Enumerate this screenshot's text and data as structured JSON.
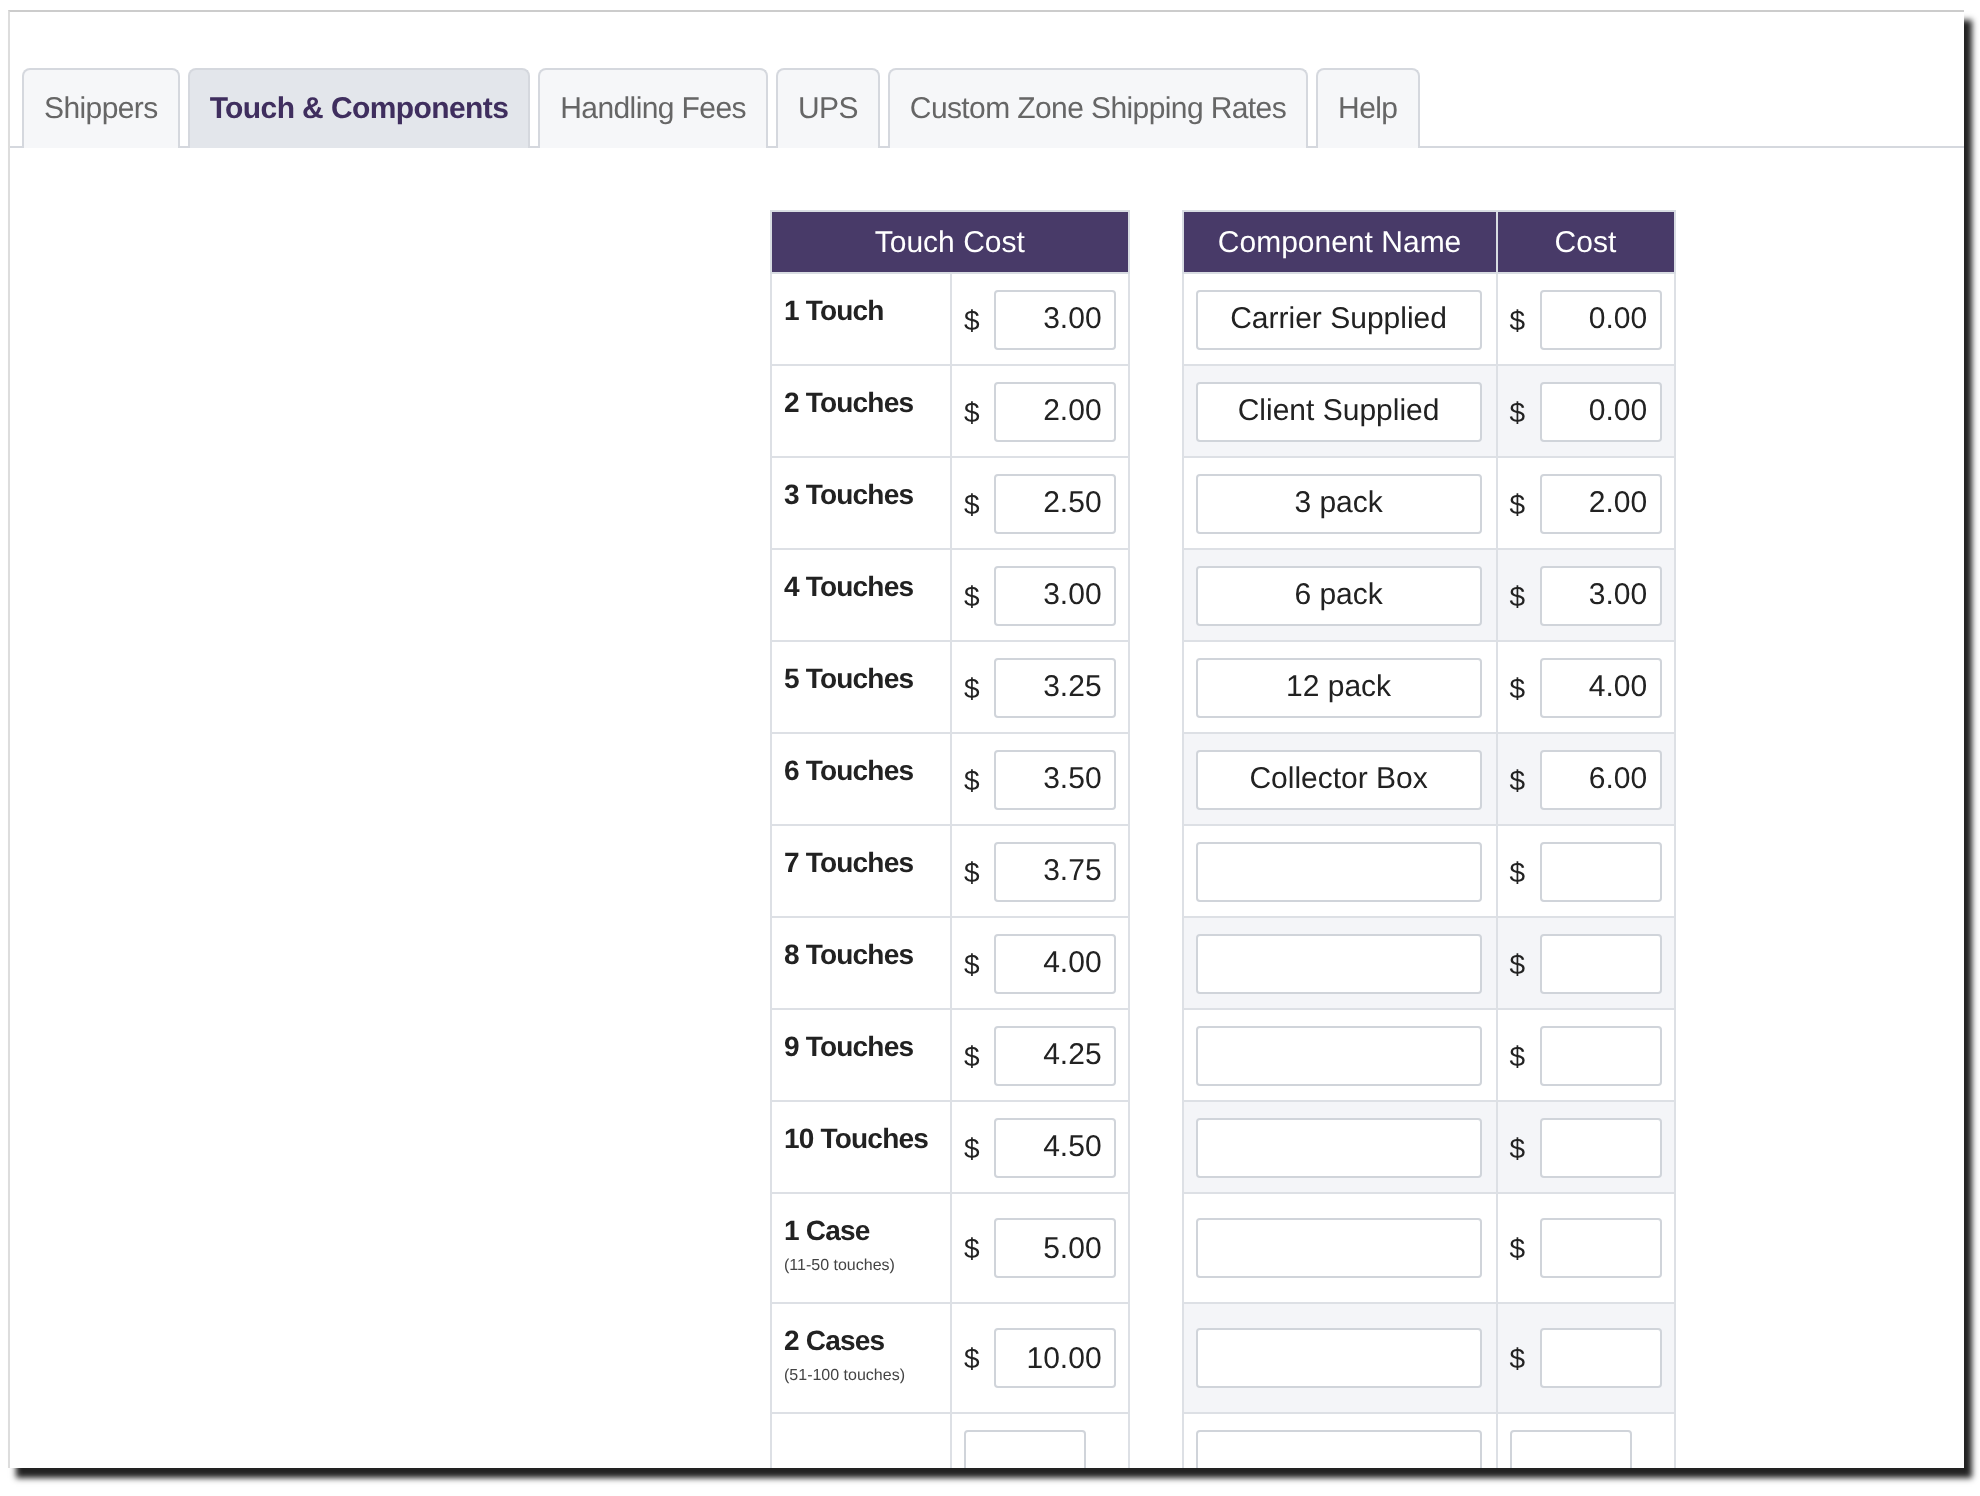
{
  "tabs": [
    {
      "label": "Shippers",
      "selected": false
    },
    {
      "label": "Touch & Components",
      "selected": true
    },
    {
      "label": "Handling Fees",
      "selected": false
    },
    {
      "label": "UPS",
      "selected": false
    },
    {
      "label": "Custom Zone Shipping Rates",
      "selected": false
    },
    {
      "label": "Help",
      "selected": false
    }
  ],
  "touch_table": {
    "header": "Touch Cost",
    "rows": [
      {
        "label": "1 Touch",
        "currency": "$",
        "value": "3.00"
      },
      {
        "label": "2 Touches",
        "currency": "$",
        "value": "2.00"
      },
      {
        "label": "3 Touches",
        "currency": "$",
        "value": "2.50"
      },
      {
        "label": "4 Touches",
        "currency": "$",
        "value": "3.00"
      },
      {
        "label": "5 Touches",
        "currency": "$",
        "value": "3.25"
      },
      {
        "label": "6 Touches",
        "currency": "$",
        "value": "3.50"
      },
      {
        "label": "7 Touches",
        "currency": "$",
        "value": "3.75"
      },
      {
        "label": "8 Touches",
        "currency": "$",
        "value": "4.00"
      },
      {
        "label": "9 Touches",
        "currency": "$",
        "value": "4.25"
      },
      {
        "label": "10 Touches",
        "currency": "$",
        "value": "4.50"
      },
      {
        "label": "1 Case",
        "note": "(11-50 touches)",
        "currency": "$",
        "value": "5.00"
      },
      {
        "label": "2 Cases",
        "note": "(51-100 touches)",
        "currency": "$",
        "value": "10.00"
      }
    ]
  },
  "component_table": {
    "columns": [
      "Component Name",
      "Cost"
    ],
    "rows": [
      {
        "name": "Carrier Supplied",
        "currency": "$",
        "cost": "0.00"
      },
      {
        "name": "Client Supplied",
        "currency": "$",
        "cost": "0.00"
      },
      {
        "name": "3 pack",
        "currency": "$",
        "cost": "2.00"
      },
      {
        "name": "6 pack",
        "currency": "$",
        "cost": "3.00"
      },
      {
        "name": "12 pack",
        "currency": "$",
        "cost": "4.00"
      },
      {
        "name": "Collector Box",
        "currency": "$",
        "cost": "6.00"
      },
      {
        "currency": "$"
      },
      {
        "currency": "$"
      },
      {
        "currency": "$"
      },
      {
        "currency": "$"
      },
      {
        "currency": "$"
      },
      {
        "currency": "$"
      }
    ]
  }
}
